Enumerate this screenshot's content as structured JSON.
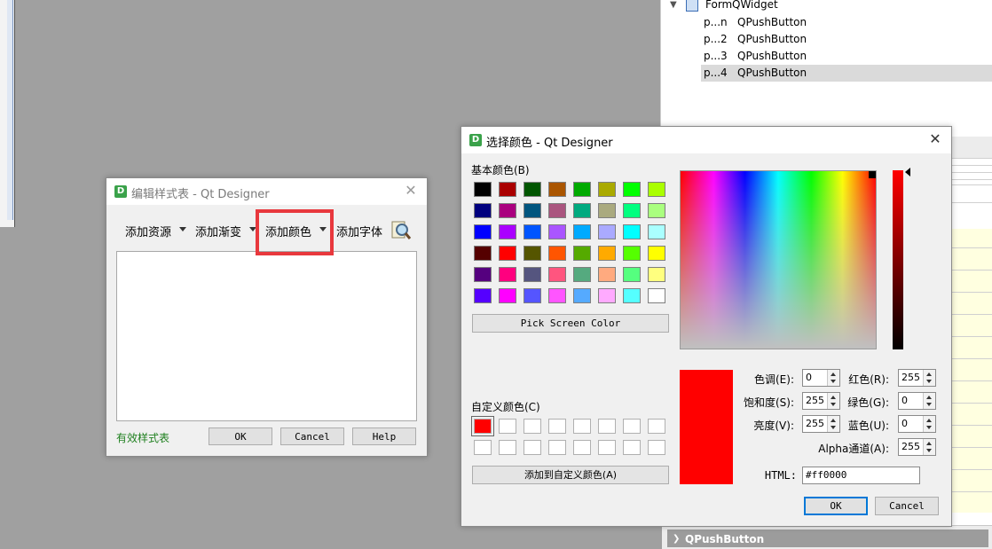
{
  "object_inspector": {
    "form_row": {
      "name": "Form",
      "class": "QWidget"
    },
    "rows": [
      {
        "name": "p...n",
        "class": "QPushButton"
      },
      {
        "name": "p...2",
        "class": "QPushButton"
      },
      {
        "name": "p...3",
        "class": "QPushButton"
      },
      {
        "name": "p...4",
        "class": "QPushButton"
      }
    ]
  },
  "property_footer": {
    "label": "QPushButton"
  },
  "stylesheet_dialog": {
    "title": "编辑样式表 - Qt Designer",
    "icon_letter": "D",
    "close": "✕",
    "toolbar": {
      "add_resource": "添加资源",
      "add_gradient": "添加渐变",
      "add_color": "添加颜色",
      "add_font": "添加字体"
    },
    "status": "有效样式表",
    "ok": "OK",
    "cancel": "Cancel",
    "help": "Help"
  },
  "color_dialog": {
    "title": "选择颜色 - Qt Designer",
    "icon_letter": "D",
    "close": "✕",
    "basic_colors_label": "基本颜色(B)",
    "basic_colors": [
      "#000000",
      "#aa0000",
      "#005500",
      "#aa5500",
      "#00aa00",
      "#aaaa00",
      "#00ff00",
      "#aaff00",
      "#00007f",
      "#aa007f",
      "#00557f",
      "#aa557f",
      "#00aa7f",
      "#aaaa7f",
      "#00ff7f",
      "#aaff7f",
      "#0000ff",
      "#aa00ff",
      "#0055ff",
      "#aa55ff",
      "#00aaff",
      "#aaaaff",
      "#00ffff",
      "#aaffff",
      "#550000",
      "#ff0000",
      "#555500",
      "#ff5500",
      "#55aa00",
      "#ffaa00",
      "#55ff00",
      "#ffff00",
      "#55007f",
      "#ff007f",
      "#55557f",
      "#ff557f",
      "#55aa7f",
      "#ffaa7f",
      "#55ff7f",
      "#ffff7f",
      "#5500ff",
      "#ff00ff",
      "#5555ff",
      "#ff55ff",
      "#55aaff",
      "#ffaaff",
      "#55ffff",
      "#ffffff"
    ],
    "pick_screen_color": "Pick Screen Color",
    "custom_colors_label": "自定义颜色(C)",
    "custom_colors": [
      "#ff0000",
      "#ffffff",
      "#ffffff",
      "#ffffff",
      "#ffffff",
      "#ffffff",
      "#ffffff",
      "#ffffff",
      "#ffffff",
      "#ffffff",
      "#ffffff",
      "#ffffff",
      "#ffffff",
      "#ffffff",
      "#ffffff",
      "#ffffff"
    ],
    "add_to_custom": "添加到自定义颜色(A)",
    "fields": {
      "hue": {
        "label": "色调(E):",
        "value": "0"
      },
      "sat": {
        "label": "饱和度(S):",
        "value": "255"
      },
      "val": {
        "label": "亮度(V):",
        "value": "255"
      },
      "red": {
        "label": "红色(R):",
        "value": "255"
      },
      "green": {
        "label": "绿色(G):",
        "value": "0"
      },
      "blue": {
        "label": "蓝色(U):",
        "value": "0"
      },
      "alpha": {
        "label": "Alpha通道(A):",
        "value": "255"
      }
    },
    "html_label": "HTML:",
    "html_value": "#ff0000",
    "current_color": "#ff0000",
    "ok": "OK",
    "cancel": "Cancel"
  }
}
